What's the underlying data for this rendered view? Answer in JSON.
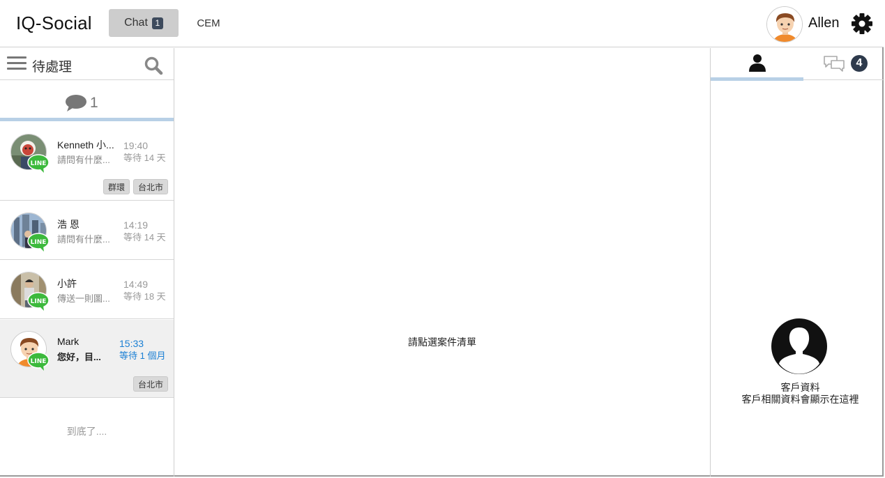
{
  "header": {
    "app_title": "IQ-Social",
    "tabs": [
      {
        "label": "Chat",
        "badge": "1"
      },
      {
        "label": "CEM"
      }
    ],
    "user_name": "Allen"
  },
  "queue": {
    "title": "待處理",
    "count": "1",
    "end_note": "到底了...."
  },
  "conversations": [
    {
      "name": "Kenneth 小...",
      "preview": "請問有什麼...",
      "time": "19:40",
      "wait": "等待 14 天",
      "tags": [
        "群環",
        "台北市"
      ],
      "channel": "LINE"
    },
    {
      "name": "浩 恩",
      "preview": "請問有什麼...",
      "time": "14:19",
      "wait": "等待 14 天",
      "tags": [],
      "channel": "LINE"
    },
    {
      "name": "小許",
      "preview": "傳送一則圖...",
      "time": "14:49",
      "wait": "等待 18 天",
      "tags": [],
      "channel": "LINE"
    },
    {
      "name": "Mark",
      "preview": "您好，目...",
      "time": "15:33",
      "wait": "等待 1 個月",
      "tags": [
        "台北市"
      ],
      "channel": "LINE"
    }
  ],
  "center": {
    "hint": "請點選案件清單"
  },
  "right_panel": {
    "chats_badge": "4",
    "profile_title": "客戶資料",
    "profile_subtitle": "客戶相關資料會顯示在這裡"
  },
  "colors": {
    "accent_underline": "#b8d0e6",
    "active_time": "#1a7fd4",
    "line_green": "#3cb93c"
  }
}
